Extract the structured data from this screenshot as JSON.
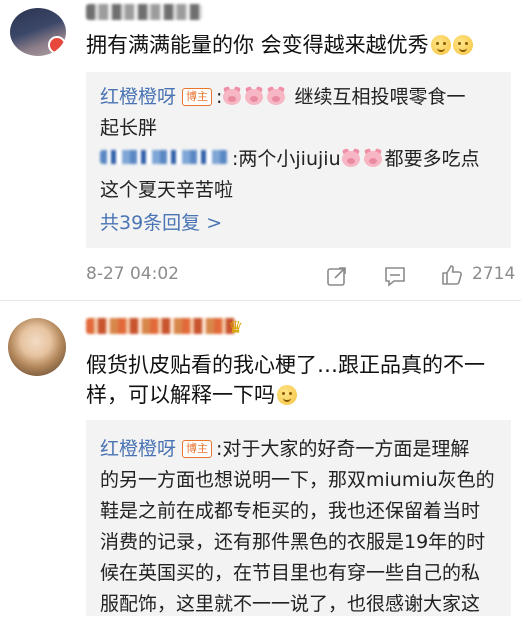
{
  "comment1": {
    "text": "拥有满满能量的你 会变得越来越优秀",
    "replies": [
      {
        "user": "红橙橙呀",
        "tag": "博主",
        "text_line1": "继续互相投喂零食一",
        "text_line2": "起长胖"
      },
      {
        "text_line1": "两个小jiujiu",
        "text_tail": "都要多吃点",
        "text_line2": "这个夏天辛苦啦"
      }
    ],
    "more_replies": "共39条回复 >",
    "time": "8-27 04:02",
    "like_count": "2714"
  },
  "comment2": {
    "text_line1": "假货扒皮贴看的我心梗了…跟正品真的不一",
    "text_line2": "样，可以解释一下吗",
    "reply": {
      "user": "红橙橙呀",
      "tag": "博主",
      "lines": [
        "对于大家的好奇一方面是理解",
        "的另一方面也想说明一下，那双miumiu灰色的",
        "鞋是之前在成都专柜买的，我也还保留着当时",
        "消费的记录，还有那件黑色的衣服是19年的时",
        "候在英国买的，在节目里也有穿一些自己的私",
        "服配饰，这里就不一一说了，也很感谢大家这"
      ]
    }
  },
  "icons": [
    "share-icon",
    "comment-icon",
    "like-icon",
    "pig-emoji-icon",
    "smile-emoji-icon",
    "crown-icon",
    "location-badge-icon"
  ]
}
